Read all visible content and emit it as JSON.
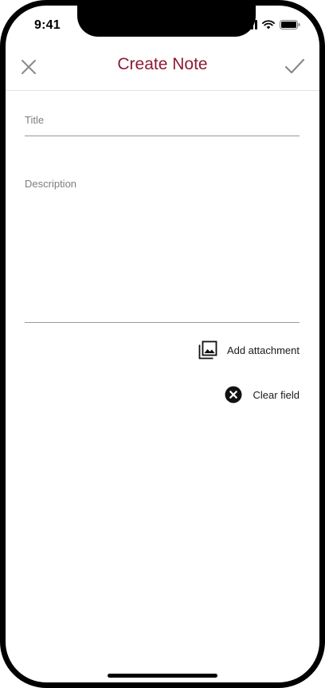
{
  "status_bar": {
    "time": "9:41",
    "icons": [
      "signal-icon",
      "wifi-icon",
      "battery-icon"
    ]
  },
  "nav": {
    "title": "Create Note",
    "close_icon": "close-icon",
    "save_icon": "checkmark-icon"
  },
  "form": {
    "title_placeholder": "Title",
    "description_placeholder": "Description"
  },
  "actions": {
    "attach_label": "Add attachment",
    "attach_icon": "image-gallery-icon",
    "clear_label": "Clear field",
    "clear_icon": "clear-circle-icon"
  },
  "colors": {
    "accent": "#8e1a35",
    "icon_gray": "#8a8a8a",
    "divider": "#9a9a9a"
  }
}
